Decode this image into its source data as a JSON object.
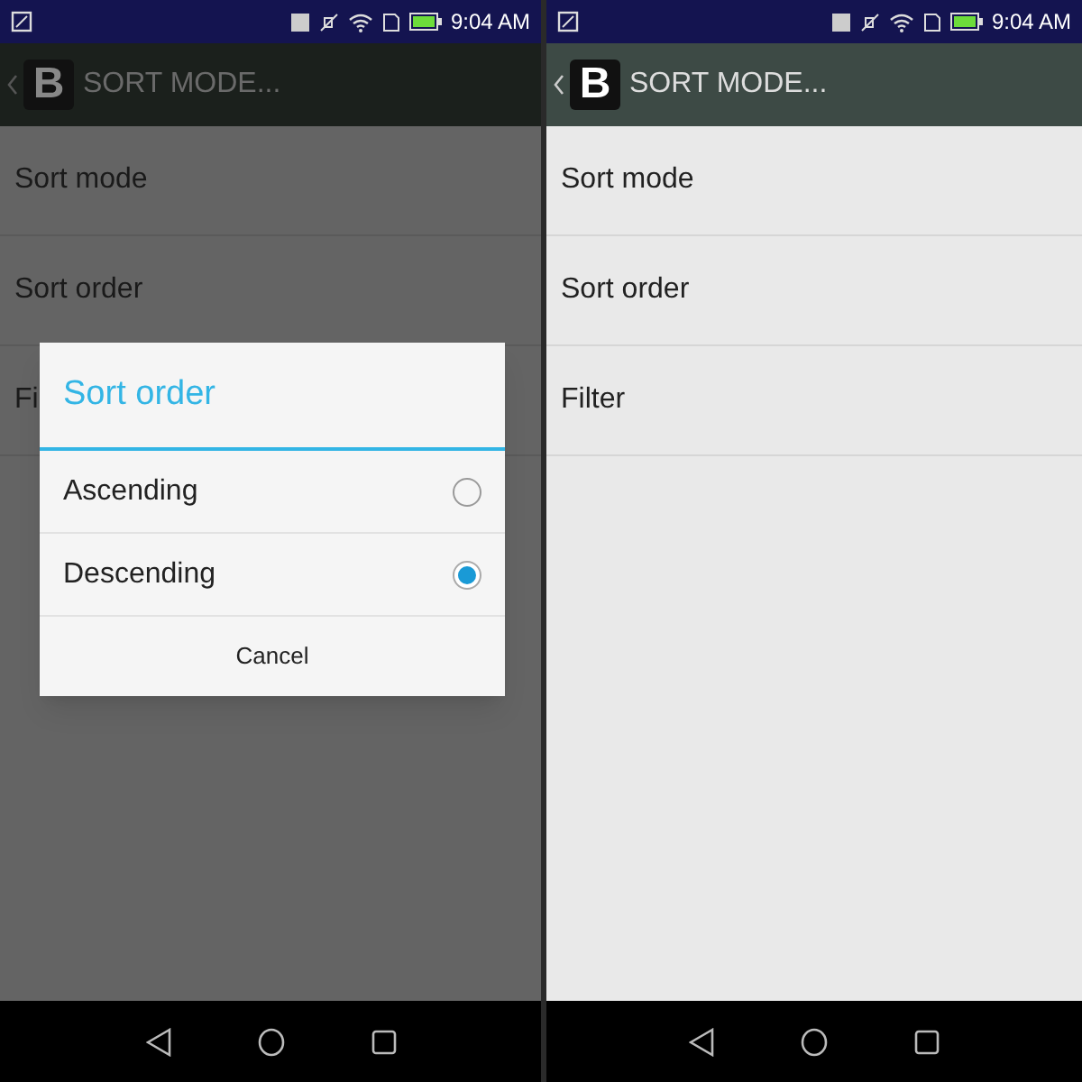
{
  "screens": [
    {
      "dimmed": true,
      "status_bar": {
        "time": "9:04 AM"
      },
      "action_bar": {
        "logo": "B",
        "title": "SORT MODE..."
      },
      "items": [
        "Sort mode",
        "Sort order",
        "Fi"
      ],
      "dialog": {
        "title": "Sort order",
        "options": [
          {
            "label": "Ascending",
            "selected": false
          },
          {
            "label": "Descending",
            "selected": true
          }
        ],
        "button": "Cancel"
      }
    },
    {
      "dimmed": false,
      "status_bar": {
        "time": "9:04 AM"
      },
      "action_bar": {
        "logo": "B",
        "title": "SORT MODE..."
      },
      "items": [
        "Sort mode",
        "Sort order",
        "Filter"
      ]
    }
  ]
}
